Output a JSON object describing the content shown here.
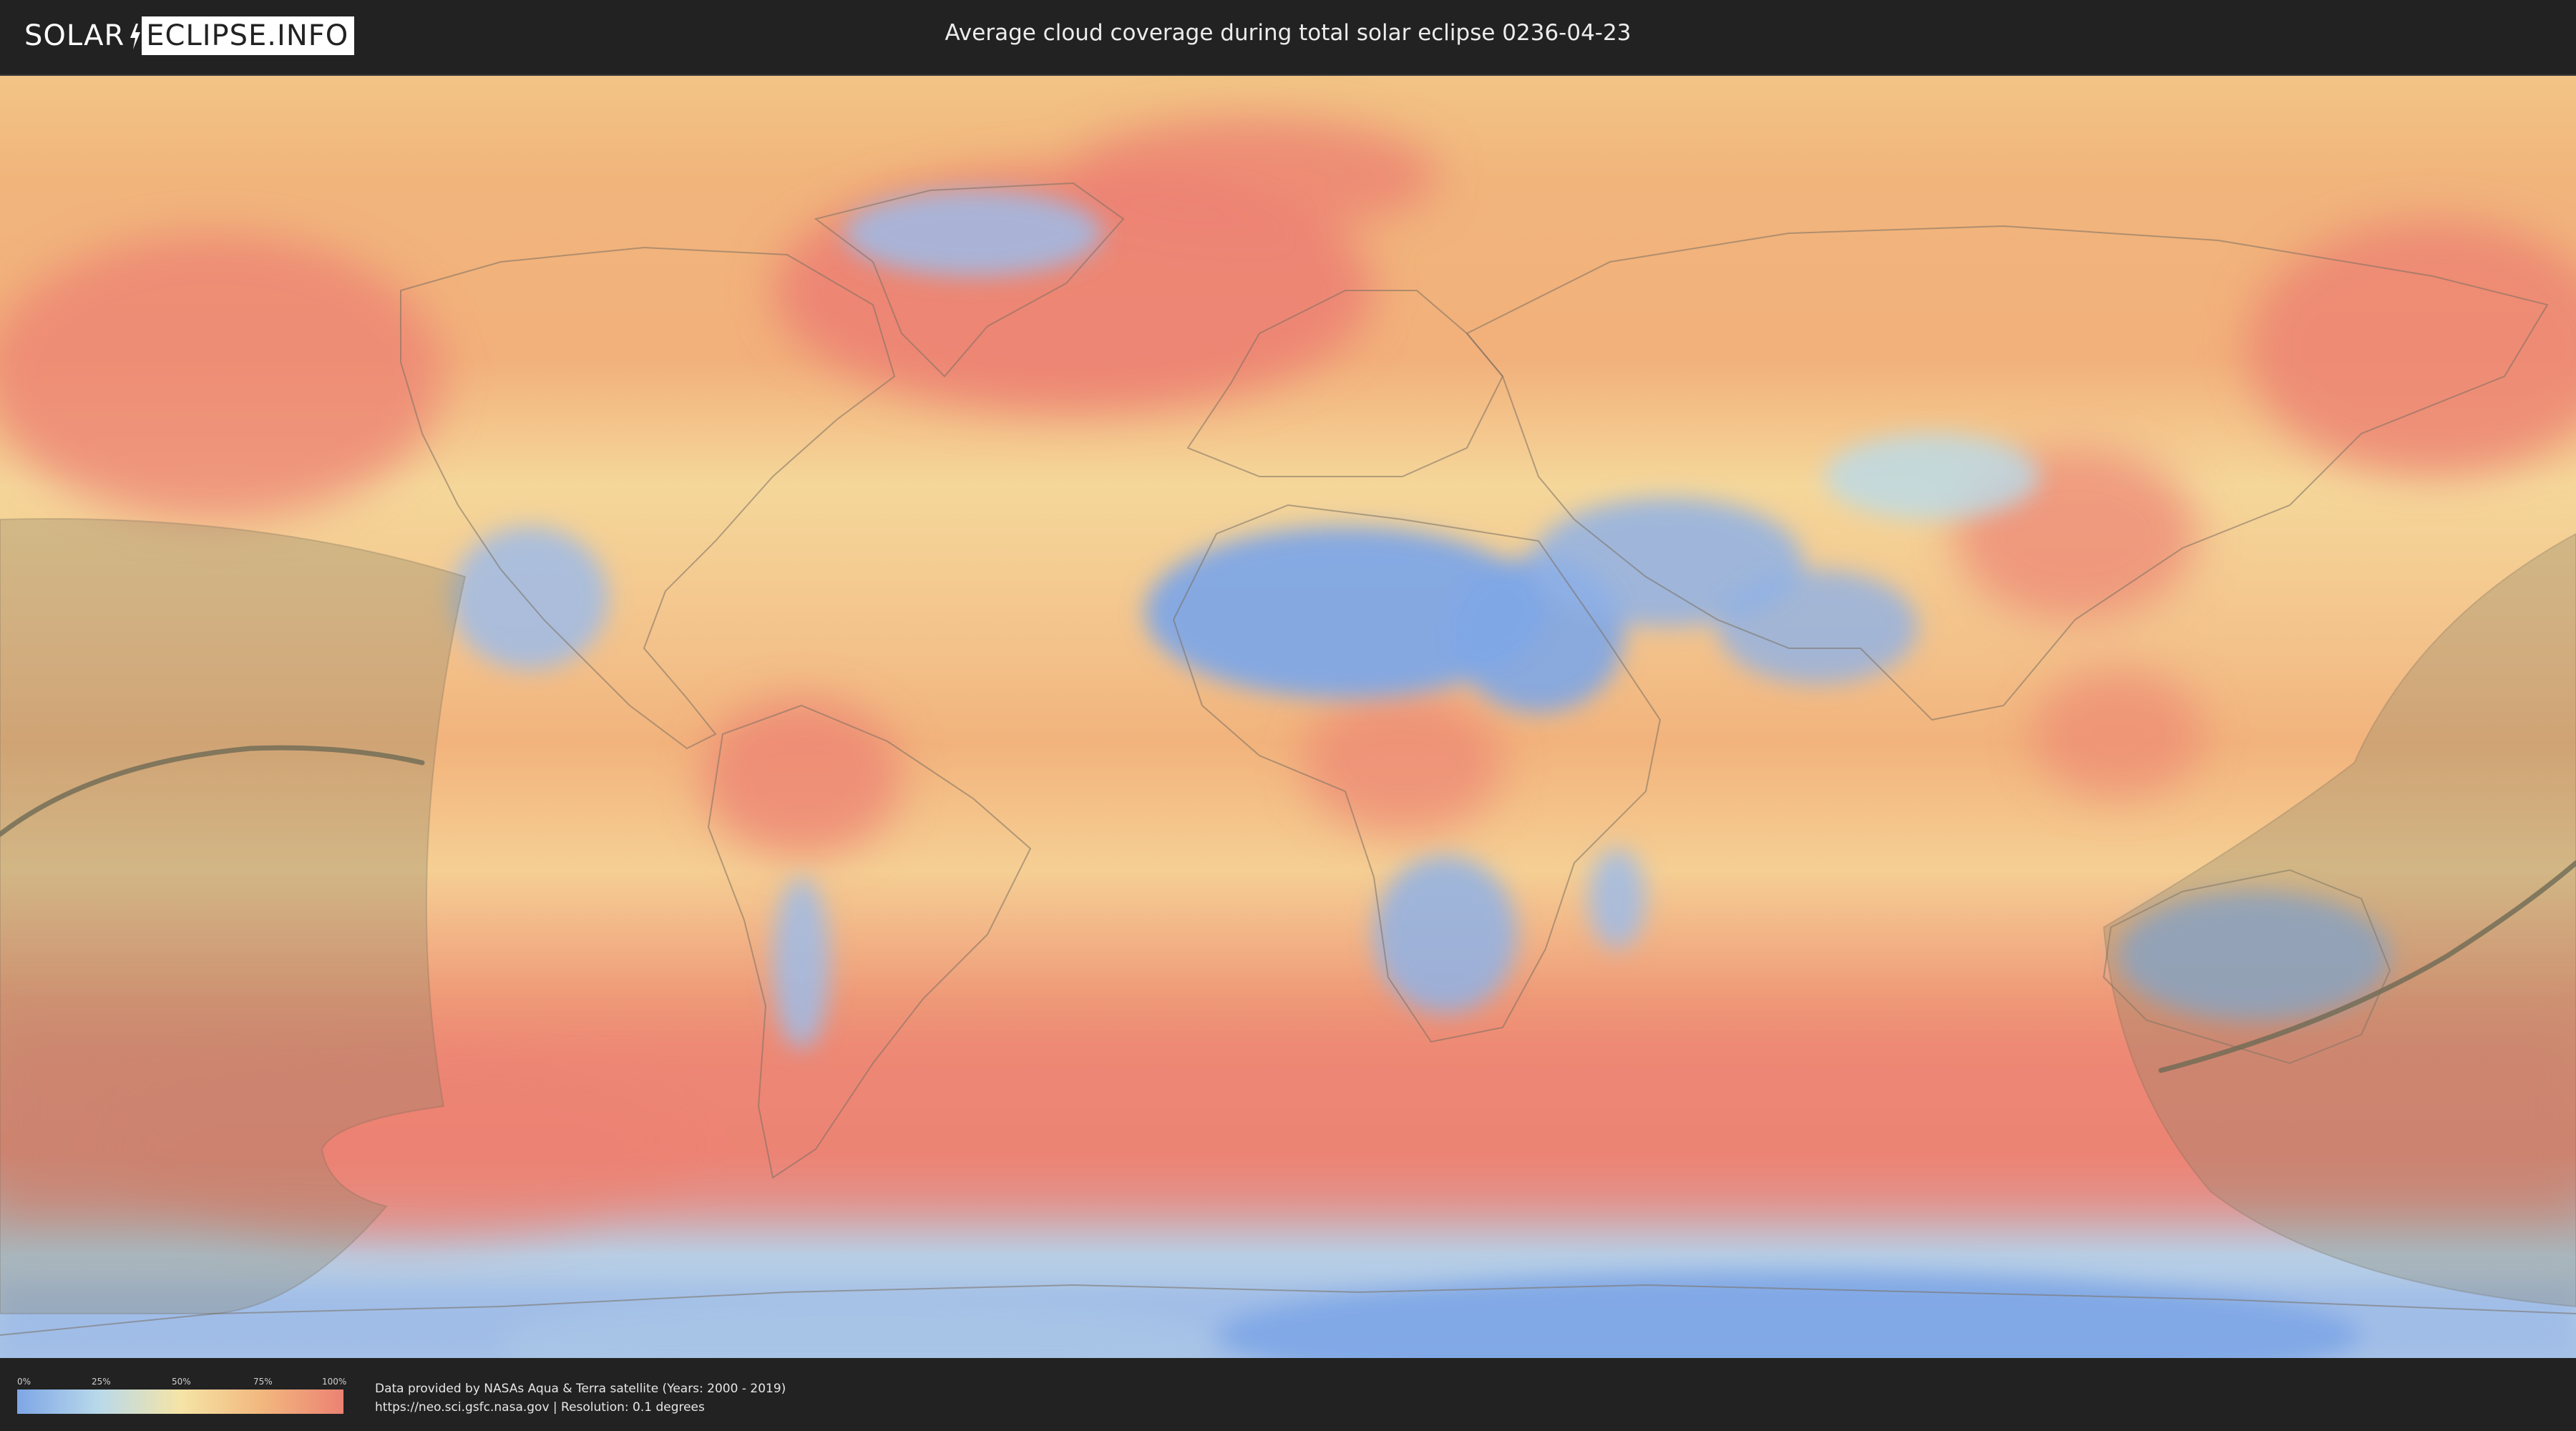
{
  "header": {
    "logo_left": "SOLAR",
    "logo_right": "ECLIPSE.INFO",
    "title": "Average cloud coverage during total solar eclipse 0236-04-23"
  },
  "legend": {
    "ticks": [
      "0%",
      "25%",
      "50%",
      "75%",
      "100%"
    ],
    "colors": [
      "#7ea6e6",
      "#b9d9ea",
      "#f5e4a6",
      "#f2b77e",
      "#ec8273"
    ]
  },
  "credits": {
    "line1": "Data provided by NASAs Aqua & Terra satellite (Years: 2000 - 2019)",
    "line2": "https://neo.sci.gsfc.nasa.gov | Resolution: 0.1 degrees"
  },
  "map": {
    "projection": "equirectangular",
    "cloud_colors": {
      "clear": "#7ea6e6",
      "low": "#b9d9ea",
      "mid": "#f5e4a6",
      "high": "#f2b77e",
      "overcast": "#ec8273"
    },
    "eclipse_overlay_color": "#8a8468"
  }
}
